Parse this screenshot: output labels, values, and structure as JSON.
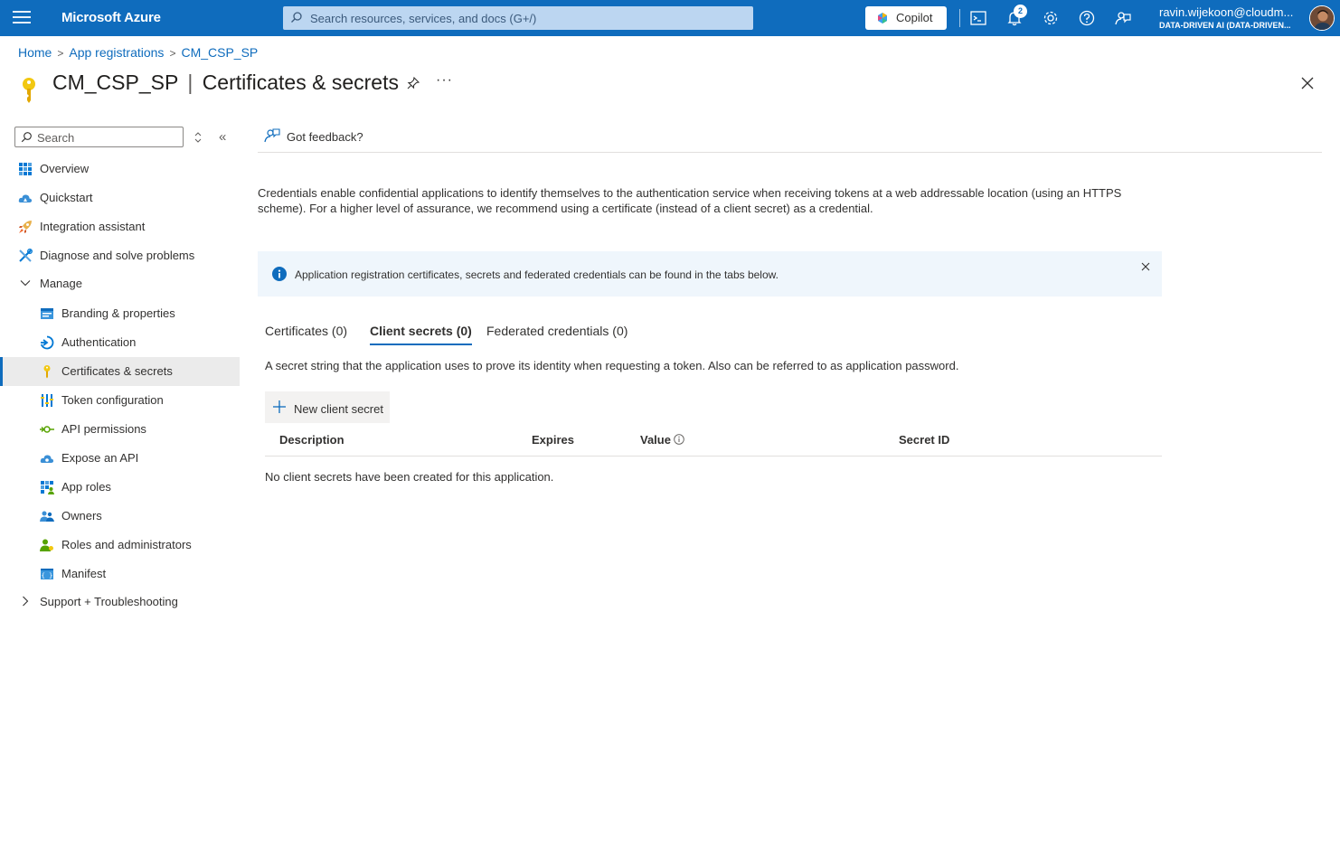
{
  "topbar": {
    "brand": "Microsoft Azure",
    "search_placeholder": "Search resources, services, and docs (G+/)",
    "copilot_label": "Copilot",
    "notification_count": "2",
    "account_email": "ravin.wijekoon@cloudm...",
    "account_tenant": "DATA-DRIVEN AI (DATA-DRIVEN..."
  },
  "breadcrumb": [
    "Home",
    "App registrations",
    "CM_CSP_SP"
  ],
  "header": {
    "resource": "CM_CSP_SP",
    "separator": "|",
    "blade": "Certificates & secrets",
    "more": "···"
  },
  "sidebar": {
    "search_placeholder": "Search",
    "collapse_glyph": "«",
    "items": [
      {
        "label": "Overview",
        "icon": "grid-icon"
      },
      {
        "label": "Quickstart",
        "icon": "cloud-icon"
      },
      {
        "label": "Integration assistant",
        "icon": "rocket-icon"
      },
      {
        "label": "Diagnose and solve problems",
        "icon": "wrench-icon"
      },
      {
        "label": "Manage",
        "icon": "chevron-down-icon"
      },
      {
        "label": "Branding & properties",
        "icon": "branding-icon"
      },
      {
        "label": "Authentication",
        "icon": "auth-icon"
      },
      {
        "label": "Certificates & secrets",
        "icon": "key-icon"
      },
      {
        "label": "Token configuration",
        "icon": "token-icon"
      },
      {
        "label": "API permissions",
        "icon": "api-permissions-icon"
      },
      {
        "label": "Expose an API",
        "icon": "cloud-api-icon"
      },
      {
        "label": "App roles",
        "icon": "app-roles-icon"
      },
      {
        "label": "Owners",
        "icon": "owners-icon"
      },
      {
        "label": "Roles and administrators",
        "icon": "roles-icon"
      },
      {
        "label": "Manifest",
        "icon": "manifest-icon"
      },
      {
        "label": "Support + Troubleshooting",
        "icon": "chevron-right-icon"
      }
    ]
  },
  "main": {
    "feedback_label": "Got feedback?",
    "description": "Credentials enable confidential applications to identify themselves to the authentication service when receiving tokens at a web addressable location (using an HTTPS scheme). For a higher level of assurance, we recommend using a certificate (instead of a client secret) as a credential.",
    "info_banner": "Application registration certificates, secrets and federated credentials can be found in the tabs below.",
    "tabs": [
      {
        "label": "Certificates (0)"
      },
      {
        "label": "Client secrets (0)",
        "selected": true
      },
      {
        "label": "Federated credentials (0)"
      }
    ],
    "tab_description": "A secret string that the application uses to prove its identity when requesting a token. Also can be referred to as application password.",
    "new_secret_label": "New client secret",
    "columns": [
      "Description",
      "Expires",
      "Value",
      "Secret ID"
    ],
    "empty_message": "No client secrets have been created for this application."
  },
  "colors": {
    "accent": "#0f6cbd",
    "key": "#f2c811"
  }
}
